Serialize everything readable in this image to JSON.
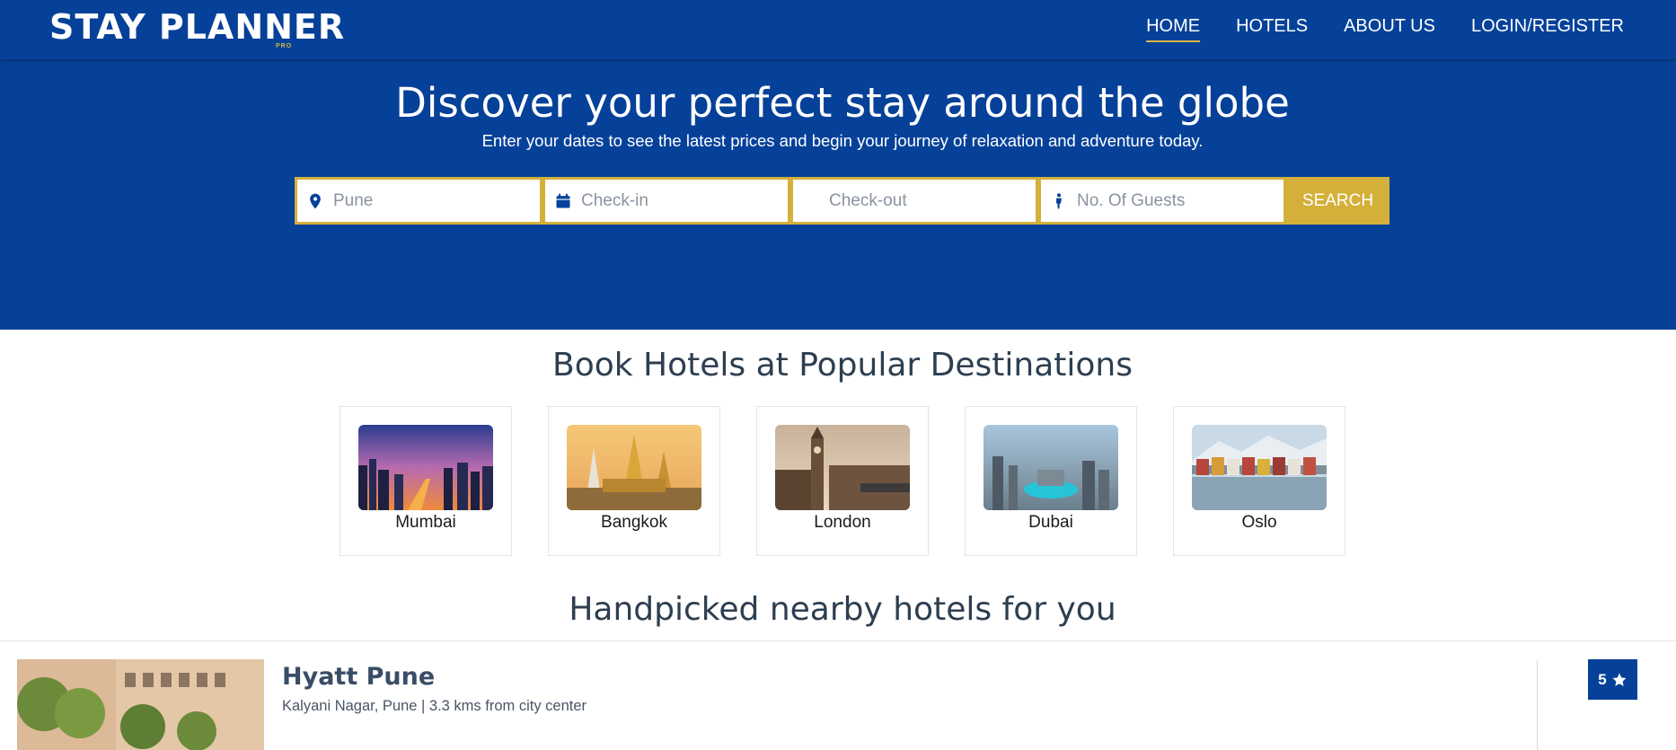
{
  "brand": {
    "name": "STAY PLANNER",
    "tag": "PRO"
  },
  "nav": {
    "items": [
      {
        "label": "HOME",
        "active": true
      },
      {
        "label": "HOTELS",
        "active": false
      },
      {
        "label": "ABOUT US",
        "active": false
      },
      {
        "label": "LOGIN/REGISTER",
        "active": false
      }
    ]
  },
  "hero": {
    "title": "Discover your perfect stay around the globe",
    "subtitle": "Enter your dates to see the latest prices and begin your journey of relaxation and adventure today."
  },
  "search": {
    "location_placeholder": "Pune",
    "checkin_placeholder": "Check-in",
    "checkout_placeholder": "Check-out",
    "guests_placeholder": "No. Of Guests",
    "button_label": "SEARCH"
  },
  "destinations": {
    "title": "Book Hotels at Popular Destinations",
    "items": [
      {
        "name": "Mumbai"
      },
      {
        "name": "Bangkok"
      },
      {
        "name": "London"
      },
      {
        "name": "Dubai"
      },
      {
        "name": "Oslo"
      }
    ]
  },
  "hotels": {
    "title": "Handpicked nearby hotels for you",
    "items": [
      {
        "name": "Hyatt Pune",
        "location": "Kalyani Nagar, Pune | 3.3 kms from city center",
        "rating": "5"
      }
    ]
  },
  "colors": {
    "primary": "#064199",
    "accent": "#d4b03a",
    "text": "#2d3e50"
  }
}
